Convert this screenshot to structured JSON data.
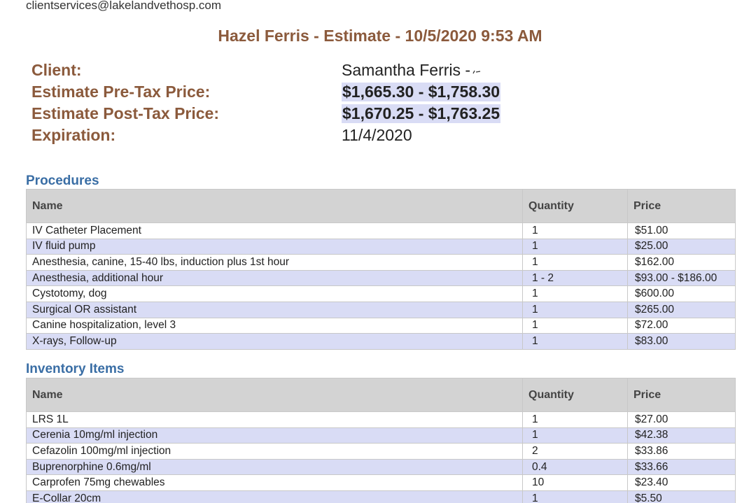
{
  "header": {
    "email": "clientservices@lakelandvethosp.com",
    "title": "Hazel Ferris - Estimate - 10/5/2020 9:53 AM"
  },
  "summary": {
    "client_label": "Client:",
    "client_value": "Samantha Ferris -",
    "pretax_label": "Estimate Pre-Tax Price:",
    "pretax_value": "$1,665.30 - $1,758.30",
    "posttax_label": "Estimate Post-Tax Price:",
    "posttax_value": "$1,670.25 - $1,763.25",
    "expiration_label": "Expiration:",
    "expiration_value": "11/4/2020"
  },
  "procedures": {
    "title": "Procedures",
    "columns": [
      "Name",
      "Quantity",
      "Price"
    ],
    "rows": [
      {
        "name": "IV Catheter Placement",
        "qty": "1",
        "price": "$51.00"
      },
      {
        "name": "IV fluid pump",
        "qty": "1",
        "price": "$25.00"
      },
      {
        "name": "Anesthesia, canine, 15-40 lbs, induction plus 1st hour",
        "qty": "1",
        "price": "$162.00"
      },
      {
        "name": "Anesthesia, additional hour",
        "qty": "1 - 2",
        "price": "$93.00 - $186.00"
      },
      {
        "name": "Cystotomy, dog",
        "qty": "1",
        "price": "$600.00"
      },
      {
        "name": "Surgical OR assistant",
        "qty": "1",
        "price": "$265.00"
      },
      {
        "name": "Canine hospitalization, level 3",
        "qty": "1",
        "price": "$72.00"
      },
      {
        "name": "X-rays, Follow-up",
        "qty": "1",
        "price": "$83.00"
      }
    ]
  },
  "inventory": {
    "title": "Inventory Items",
    "columns": [
      "Name",
      "Quantity",
      "Price"
    ],
    "rows": [
      {
        "name": "LRS 1L",
        "qty": "1",
        "price": "$27.00"
      },
      {
        "name": "Cerenia 10mg/ml injection",
        "qty": "1",
        "price": "$42.38"
      },
      {
        "name": "Cefazolin 100mg/ml injection",
        "qty": "2",
        "price": "$33.86"
      },
      {
        "name": "Buprenorphine 0.6mg/ml",
        "qty": "0.4",
        "price": "$33.66"
      },
      {
        "name": "Carprofen 75mg chewables",
        "qty": "10",
        "price": "$23.40"
      },
      {
        "name": "E-Collar 20cm",
        "qty": "1",
        "price": "$5.50"
      }
    ]
  },
  "colors": {
    "heading_brown": "#8b5a3c",
    "section_blue": "#3a6ea5",
    "row_highlight": "#d9dcf5",
    "header_gray": "#d3d3d3"
  }
}
